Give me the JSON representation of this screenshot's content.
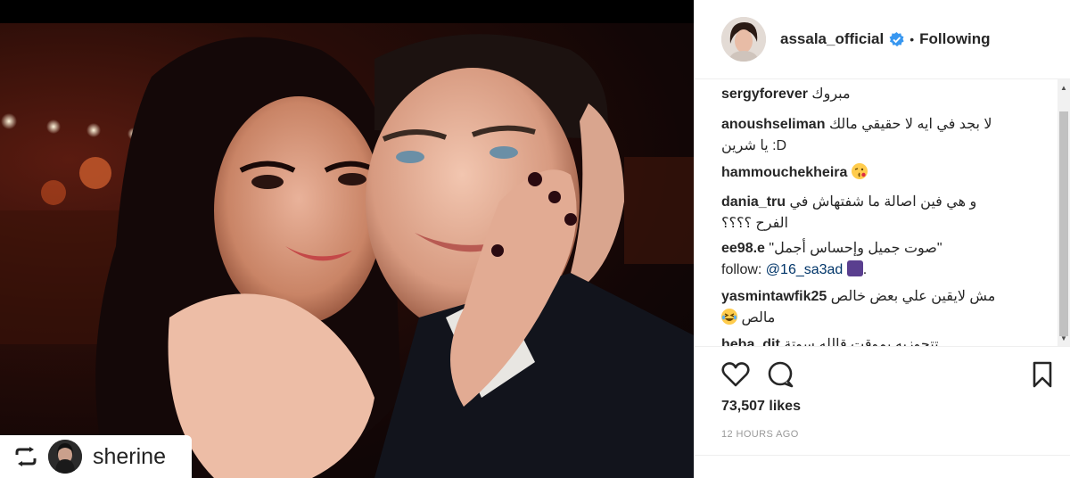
{
  "post": {
    "repost_name": "sherine",
    "icons": {
      "repost": "repost-icon"
    }
  },
  "header": {
    "username": "assala_official",
    "dot": "•",
    "follow_status": "Following"
  },
  "comments": [
    {
      "user": "sergyforever",
      "text": "مبروك"
    },
    {
      "user": "anoushseliman",
      "text": "لا بجد في ايه لا حقيقي مالك",
      "text2": "يا شرين :D"
    },
    {
      "user": "hammouchekheira",
      "text": "",
      "emoji": "face-kiss-emoji"
    },
    {
      "user": "dania_tru",
      "text": "و هي فين اصالة ما شفتهاش في",
      "text2": "الفرح ؟؟؟؟"
    },
    {
      "user": "ee98.e",
      "text": "\"صوت جميل وإحساس أجمل\"",
      "text2_prefix": "follow: ",
      "link": "@16_sa3ad",
      "suffix": "."
    },
    {
      "user": "yasmintawfik25",
      "text": "مش لايقين علي بعض خالص",
      "text2": "مالص",
      "emoji": "laughing-emoji"
    },
    {
      "user": "heba_dit",
      "text": "تتجوزيه بموقت قالله سوتة"
    }
  ],
  "actions": {
    "like_icon": "heart-icon",
    "comment_icon": "comment-icon",
    "save_icon": "bookmark-icon"
  },
  "likes": "73,507 likes",
  "timestamp": "12 HOURS AGO",
  "colors": {
    "verified": "#3897f0",
    "link": "#003569",
    "divider": "#efefef"
  }
}
